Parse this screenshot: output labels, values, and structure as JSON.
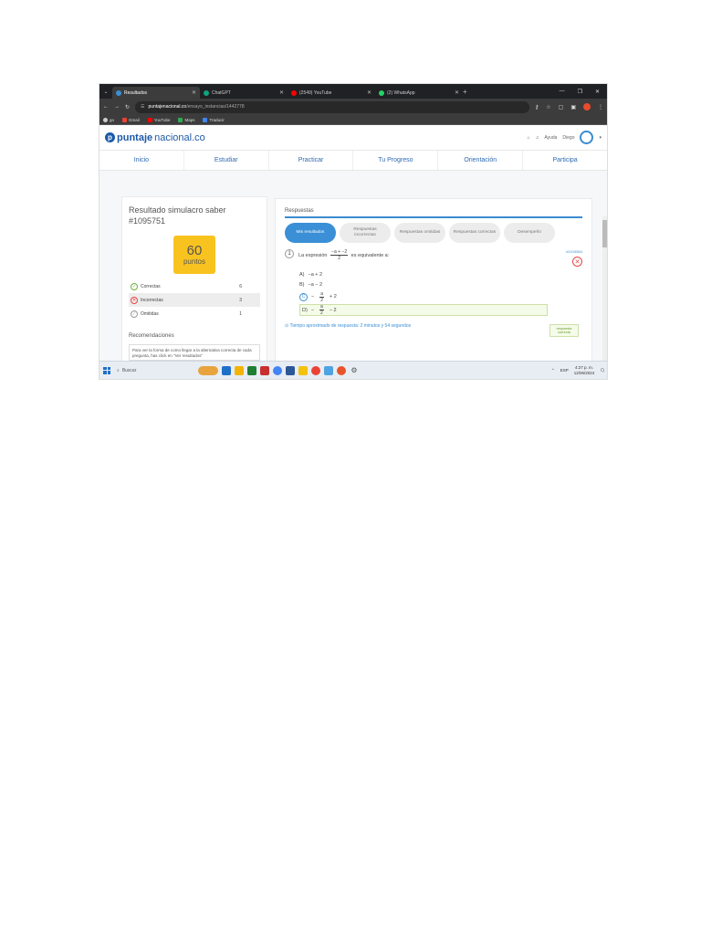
{
  "browser": {
    "tabs": [
      {
        "label": "Resultados",
        "color": "#3a8fd6",
        "active": true
      },
      {
        "label": "ChatGPT",
        "color": "#10a37f",
        "active": false
      },
      {
        "label": "(2549) YouTube",
        "color": "#ff0000",
        "active": false
      },
      {
        "label": "(2) WhatsApp",
        "color": "#25d366",
        "active": false
      }
    ],
    "url_host": "puntajenacional.co",
    "url_path": "/ensayo_instancias/1442778",
    "bookmarks": [
      {
        "label": "go",
        "color": "#cccccc"
      },
      {
        "label": "Gmail",
        "color": "#ea4335"
      },
      {
        "label": "YouTube",
        "color": "#ff0000"
      },
      {
        "label": "Maps",
        "color": "#34a853"
      },
      {
        "label": "Traducir",
        "color": "#4285f4"
      }
    ]
  },
  "site": {
    "logo_bold": "puntaje",
    "logo_rest": "nacional.co",
    "header_links": [
      "Ayuda",
      "Diego"
    ],
    "nav": [
      "Inicio",
      "Estudiar",
      "Practicar",
      "Tu Progreso",
      "Orientación",
      "Participa"
    ]
  },
  "result": {
    "title": "Resultado simulacro saber #1095751",
    "score": "60",
    "score_label": "puntos",
    "stats": [
      {
        "label": "Correctas",
        "value": "6",
        "color": "#6db33f",
        "icon": "check-icon"
      },
      {
        "label": "Incorrectas",
        "value": "3",
        "color": "#e64646",
        "icon": "x-icon"
      },
      {
        "label": "Omitidas",
        "value": "1",
        "color": "#999999",
        "icon": "slash-icon"
      }
    ],
    "recommendations_title": "Recomendaciones",
    "recommendation_text": "Para ver la forma de como llegar a la alternativa correcta de cada pregunta, has click en \"Ver resultados\""
  },
  "answers": {
    "header": "Respuestas",
    "pills": [
      "Mis resultados",
      "Respuestas incorrectas",
      "Respuestas omitidas",
      "Respuestas correctas",
      "Desempeño"
    ],
    "question": {
      "number": "1",
      "prefix": "La expresión",
      "numerator": "−a + −2",
      "denominator": "2",
      "suffix": "es equivalente a:",
      "id": "#1015554",
      "options": [
        {
          "letter": "A)",
          "text": "−a + 2"
        },
        {
          "letter": "B)",
          "text": "−a − 2"
        },
        {
          "letter": "C)",
          "num": "a",
          "den": "2",
          "text": "+ 2",
          "sign": "−"
        },
        {
          "letter": "D)",
          "num": "a",
          "den": "2",
          "text": "− 2",
          "sign": "−"
        }
      ],
      "correct_badge": "respuesta correcta",
      "time": "Tiempo aproximado de respuesta: 2 minutos y 54 segundos"
    }
  },
  "taskbar": {
    "search": "Buscar",
    "lang": "ESP",
    "time": "4:27 p. m.",
    "date": "12/06/2024",
    "apps": [
      "#e8a33d",
      "#1e6fc8",
      "#f2b400",
      "#1e7e34",
      "#c7302e",
      "#4285f4",
      "#2b5797",
      "#f4c20d",
      "#ea4335",
      "#4fa3e0",
      "#e8552b",
      "#555555"
    ]
  }
}
